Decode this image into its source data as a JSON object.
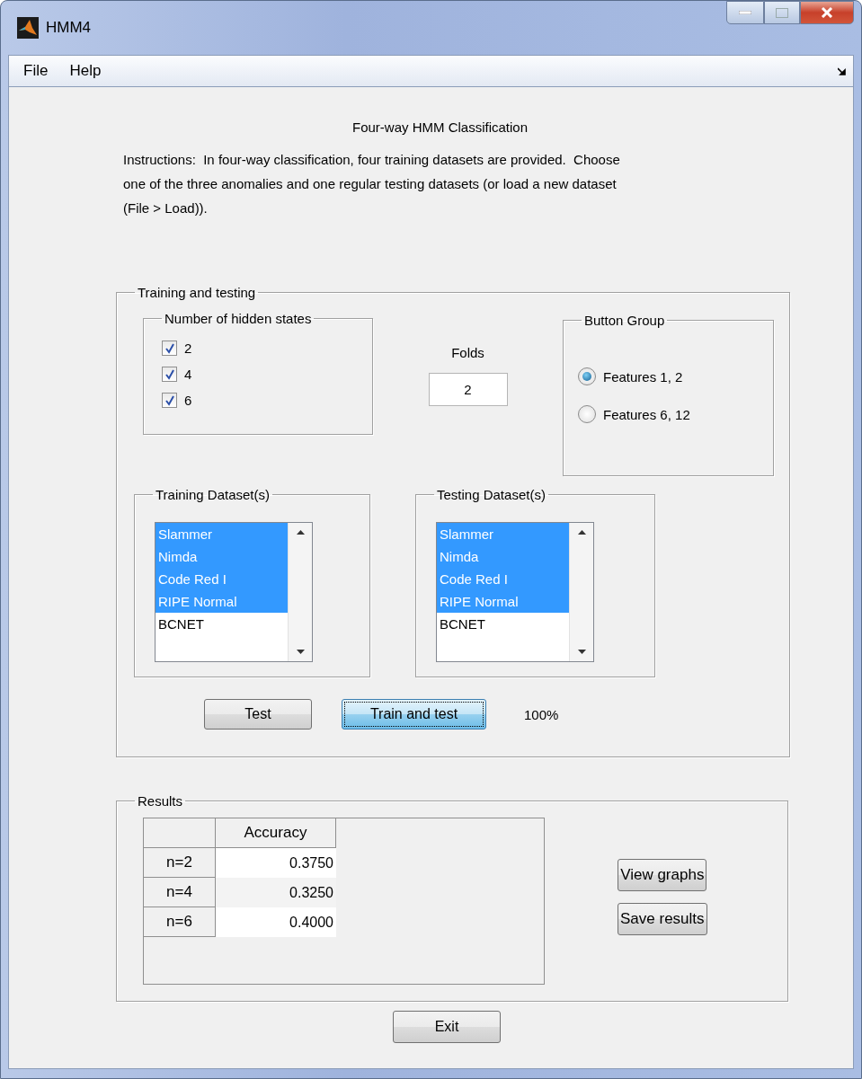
{
  "window": {
    "title": "HMM4"
  },
  "menu": [
    {
      "label": "File"
    },
    {
      "label": "Help"
    }
  ],
  "heading": "Four-way HMM Classification",
  "instructions": "Instructions:  In four-way classification, four training datasets are provided.  Choose\none of the three anomalies and one regular testing datasets (or load a new dataset\n(File > Load)).",
  "training_panel": {
    "title": "Training and testing",
    "hidden_states": {
      "title": "Number of hidden states",
      "options": [
        {
          "label": "2",
          "checked": true
        },
        {
          "label": "4",
          "checked": true
        },
        {
          "label": "6",
          "checked": true
        }
      ]
    },
    "folds": {
      "label": "Folds",
      "value": "2"
    },
    "button_group": {
      "title": "Button Group",
      "options": [
        {
          "label": "Features 1, 2",
          "selected": true
        },
        {
          "label": "Features 6, 12",
          "selected": false
        }
      ]
    },
    "training_datasets": {
      "title": "Training Dataset(s)",
      "items": [
        {
          "label": "Slammer",
          "selected": true
        },
        {
          "label": "Nimda",
          "selected": true
        },
        {
          "label": "Code Red I",
          "selected": true
        },
        {
          "label": "RIPE Normal",
          "selected": true
        },
        {
          "label": "BCNET",
          "selected": false
        }
      ]
    },
    "testing_datasets": {
      "title": "Testing Dataset(s)",
      "items": [
        {
          "label": "Slammer",
          "selected": true
        },
        {
          "label": "Nimda",
          "selected": true
        },
        {
          "label": "Code Red I",
          "selected": true
        },
        {
          "label": "RIPE Normal",
          "selected": true
        },
        {
          "label": "BCNET",
          "selected": false
        }
      ]
    },
    "buttons": [
      {
        "label": "Test",
        "focused": false
      },
      {
        "label": "Train and test",
        "focused": true
      }
    ],
    "progress": "100%"
  },
  "results_panel": {
    "title": "Results",
    "table": {
      "columns": [
        "Accuracy"
      ],
      "rows": [
        {
          "label": "n=2",
          "value": "0.3750"
        },
        {
          "label": "n=4",
          "value": "0.3250"
        },
        {
          "label": "n=6",
          "value": "0.4000"
        }
      ]
    },
    "buttons": [
      "View graphs",
      "Save results"
    ]
  },
  "exit_button": "Exit"
}
